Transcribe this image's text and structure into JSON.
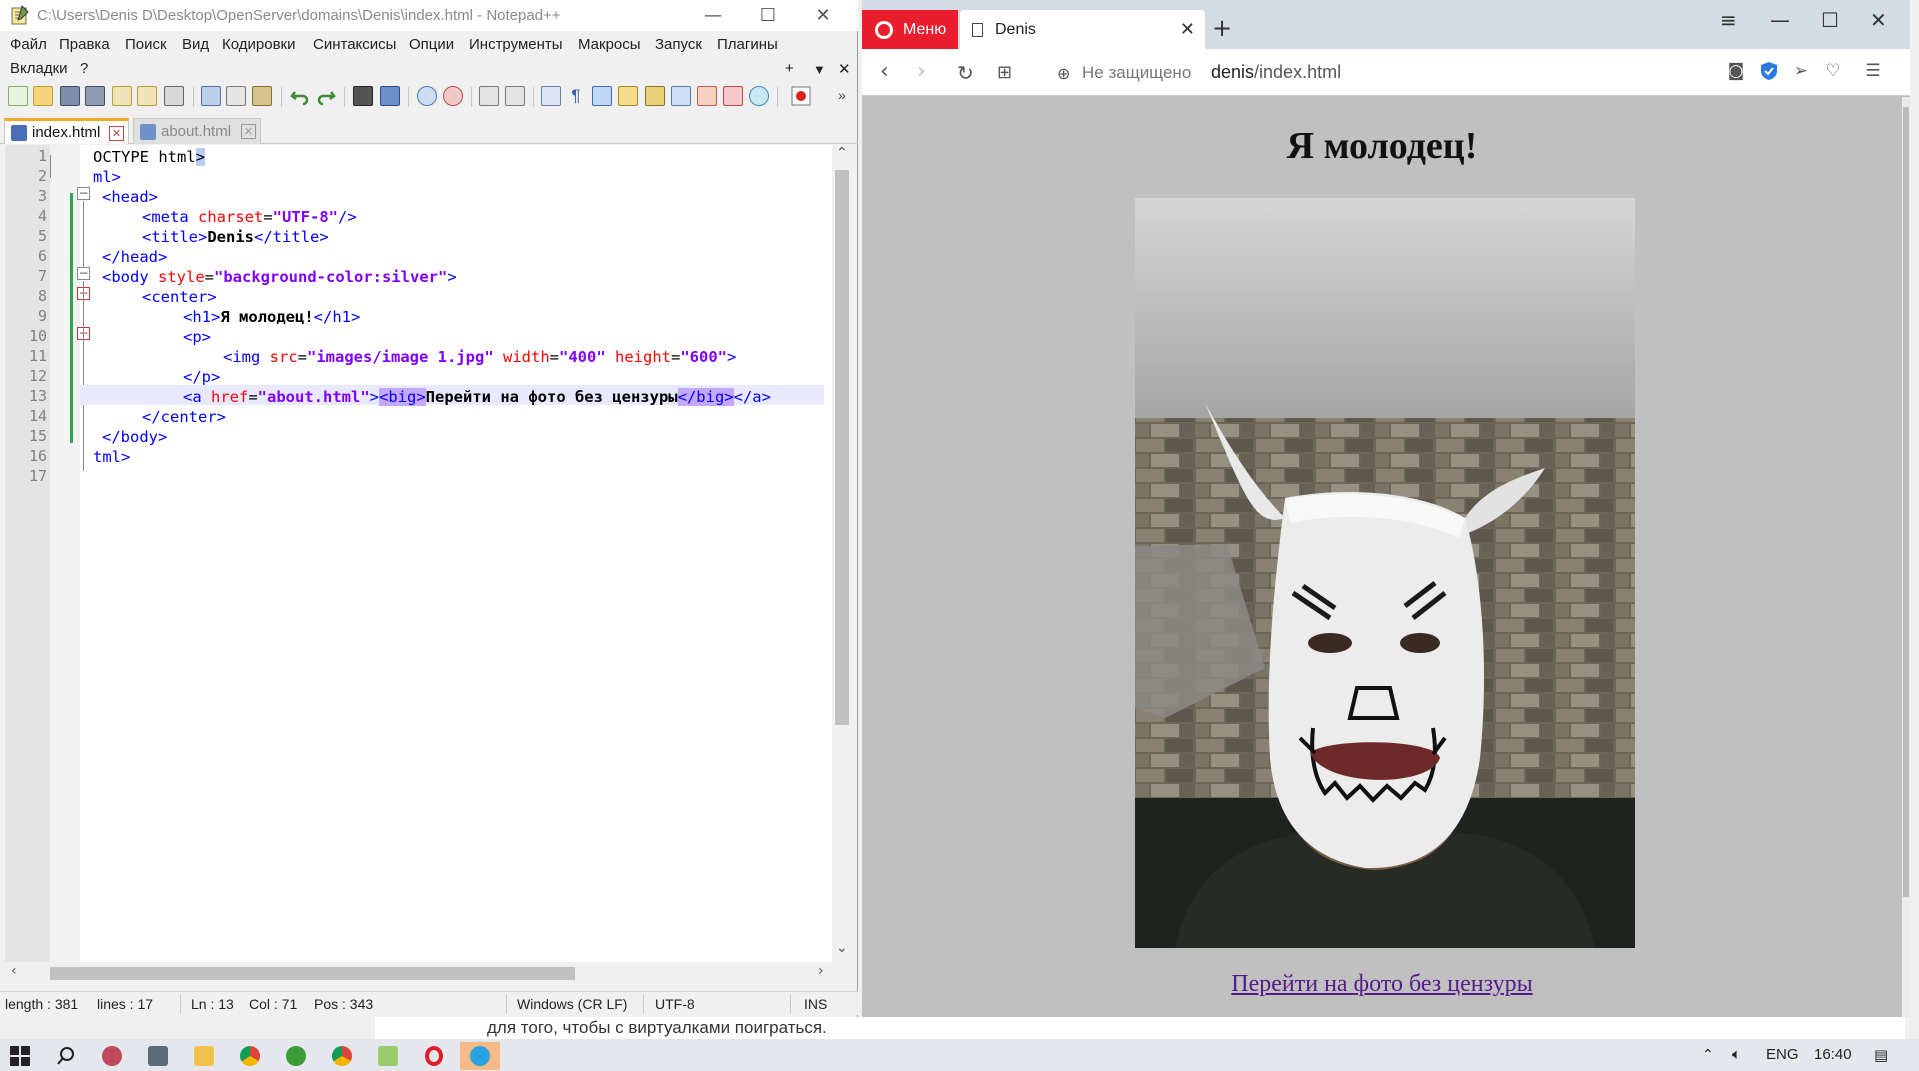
{
  "notepad": {
    "title": "C:\\Users\\Denis D\\Desktop\\OpenServer\\domains\\Denis\\index.html - Notepad++",
    "menu": [
      "Файл",
      "Правка",
      "Поиск",
      "Вид",
      "Кодировки",
      "Синтаксисы",
      "Опции",
      "Инструменты",
      "Макросы",
      "Запуск",
      "Плагины"
    ],
    "menu2": [
      "Вкладки",
      "?"
    ],
    "menu_right": [
      "+",
      "▼",
      "✕"
    ],
    "tabs": [
      {
        "label": "index.html",
        "active": true
      },
      {
        "label": "about.html",
        "active": false
      }
    ],
    "line_numbers": [
      "1",
      "2",
      "3",
      "4",
      "5",
      "6",
      "7",
      "8",
      "9",
      "10",
      "11",
      "12",
      "13",
      "14",
      "15",
      "16",
      "17"
    ],
    "code": {
      "l1": "OCTYPE html",
      "l1b": ">",
      "l2": "ml>",
      "l3": "<head>",
      "l4a": "<meta ",
      "l4b": "charset",
      "l4c": "=",
      "l4d": "\"UTF-8\"",
      "l4e": "/>",
      "l5a": "<title>",
      "l5b": "Denis",
      "l5c": "</title>",
      "l6": "</head>",
      "l7a": "<body ",
      "l7b": "style",
      "l7c": "=",
      "l7d": "\"background-color:silver\"",
      "l7e": ">",
      "l8": "<center>",
      "l9a": "<h1>",
      "l9b": "Я молодец!",
      "l9c": "</h1>",
      "l10": "<p>",
      "l11a": "<img ",
      "l11b": "src",
      "l11c": "=",
      "l11d": "\"images/image 1.jpg\"",
      "l11e": " width",
      "l11f": "=",
      "l11g": "\"400\"",
      "l11h": " height",
      "l11i": "=",
      "l11j": "\"600\"",
      "l11k": ">",
      "l12": "</p>",
      "l13a": "<a ",
      "l13b": "href",
      "l13c": "=",
      "l13d": "\"about.html\"",
      "l13e": ">",
      "l13f": "<big>",
      "l13g": "Перейти на фото без цензуры",
      "l13h": "</big>",
      "l13i": "</a>",
      "l14": "</center>",
      "l15": "</body>",
      "l16": "tml>"
    },
    "status": {
      "length": "length : 381",
      "lines": "lines : 17",
      "ln": "Ln : 13",
      "col": "Col : 71",
      "pos": "Pos : 343",
      "eol": "Windows (CR LF)",
      "encoding": "UTF-8",
      "mode": "INS"
    }
  },
  "opera": {
    "menu_label": "Меню",
    "tab_title": "Denis",
    "new_tab": "+",
    "security": "Не защищено",
    "url_host": "denis",
    "url_path": "/index.html",
    "page": {
      "heading": "Я молодец!",
      "link_text": "Перейти на фото без цензуры"
    }
  },
  "behind_text": "для того, чтобы с виртуалками поиграться.",
  "taskbar": {
    "lang": "ENG",
    "time": "16:40"
  },
  "colors": {
    "opera_red": "#ea1d2c",
    "page_bg": "#c0c0c0",
    "link": "#551a8b",
    "tag_blue": "#0000ff",
    "attr_red": "#ff0000",
    "value_purple": "#8000ff"
  }
}
